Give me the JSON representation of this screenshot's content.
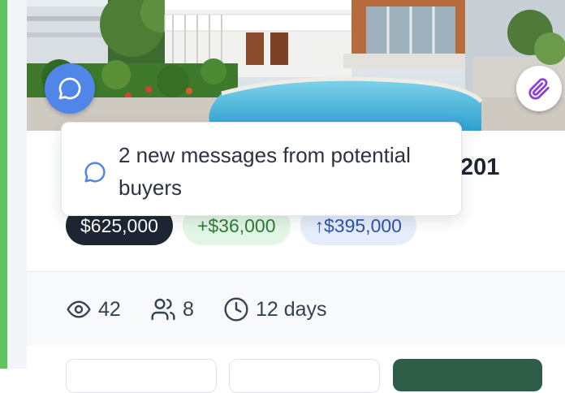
{
  "listing": {
    "title_fragment": "201",
    "price": "$625,000",
    "gain": "+$36,000",
    "appreciation": "↑$395,000"
  },
  "stats": {
    "views": "42",
    "interested": "8",
    "days_listed": "12 days"
  },
  "tooltip": {
    "message": "2 new messages from potential buyers"
  },
  "icons": {
    "chat": "chat-bubble-icon",
    "attach": "paperclip-icon",
    "views": "eye-icon",
    "interested": "users-icon",
    "days": "clock-icon"
  },
  "colors": {
    "accent_green": "#5cc55e",
    "chat_blue": "#4f86e8",
    "attach_purple": "#8b3fd9",
    "price_chip": "#1f2633",
    "gain_chip_bg": "#e3f6e6",
    "gain_chip_text": "#2d7d36",
    "up_chip_bg": "#e6edfb",
    "up_chip_text": "#2f53b3",
    "primary_button": "#2f5e48"
  }
}
